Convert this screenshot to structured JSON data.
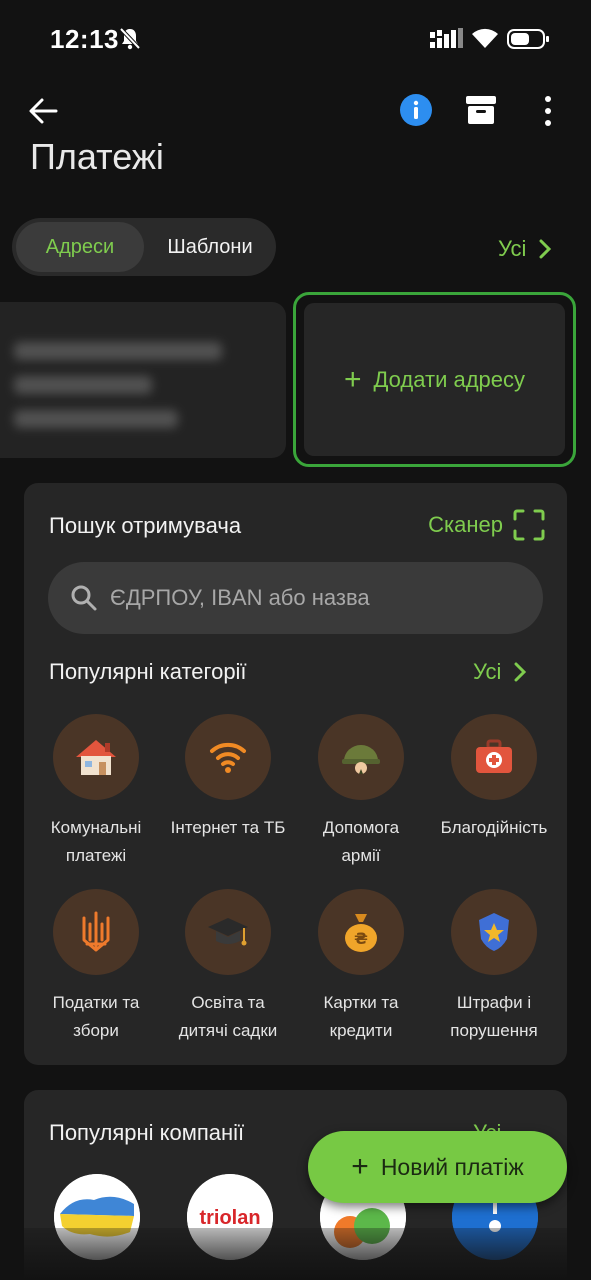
{
  "status_bar": {
    "time": "12:13"
  },
  "header": {
    "title": "Платежі"
  },
  "tabs": [
    {
      "label": "Адреси",
      "active": true
    },
    {
      "label": "Шаблони",
      "active": false
    }
  ],
  "addresses": {
    "all_label": "Усі",
    "add_label": "Додати адресу"
  },
  "recipient_search": {
    "title": "Пошук отримувача",
    "scanner_label": "Сканер",
    "placeholder": "ЄДРПОУ, IBAN або назва"
  },
  "categories": {
    "title": "Популярні категорії",
    "all_label": "Усі",
    "items": [
      {
        "icon": "house-icon",
        "line1": "Комунальні",
        "line2": "платежі"
      },
      {
        "icon": "wifi-icon",
        "line1": "Інтернет та ТБ",
        "line2": ""
      },
      {
        "icon": "helmet-icon",
        "line1": "Допомога",
        "line2": "армії"
      },
      {
        "icon": "first-aid-kit-icon",
        "line1": "Благодійність",
        "line2": ""
      },
      {
        "icon": "trident-icon",
        "line1": "Податки та",
        "line2": "збори"
      },
      {
        "icon": "graduation-cap-icon",
        "line1": "Освіта та",
        "line2": "дитячі садки"
      },
      {
        "icon": "money-bag-icon",
        "line1": "Картки та",
        "line2": "кредити"
      },
      {
        "icon": "police-badge-icon",
        "line1": "Штрафи і",
        "line2": "порушення"
      }
    ]
  },
  "companies": {
    "title": "Популярні компанії",
    "all_label": "Усі",
    "logos": [
      {
        "name": "ukraine-map-logo"
      },
      {
        "name": "triolan-logo",
        "text": "triolan"
      },
      {
        "name": "kyivstar-like-logo"
      },
      {
        "name": "blue-logo"
      }
    ]
  },
  "fab": {
    "label": "Новий платіж"
  },
  "colors": {
    "accent": "#7fcc4e",
    "fab": "#77c944",
    "category_bg": "#4a3526",
    "panel": "#262626",
    "background": "#121212"
  }
}
